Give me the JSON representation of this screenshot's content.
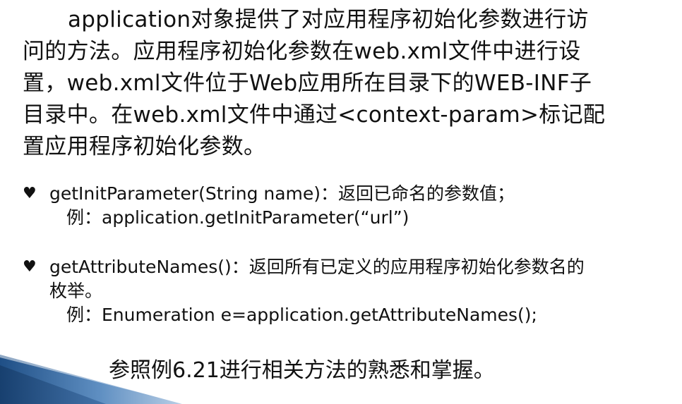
{
  "colors": {
    "text": "#111111",
    "wedge_dark": "#1f4f86",
    "wedge_light": "#8fb2d8"
  },
  "bullet_icon": "heart-bullet",
  "paragraph": {
    "line1": "application对象提供了对应用程序初始化参数进行访",
    "line2": "问的方法。应用程序初始化参数在web.xml文件中进行设",
    "line3": "置，web.xml文件位于Web应用所在目录下的WEB-INF子",
    "line4": "目录中。在web.xml文件中通过<context-param>标记配",
    "line5": "置应用程序初始化参数。"
  },
  "bullets": [
    {
      "glyph": "♥",
      "text": "getInitParameter(String name)：返回已命名的参数值；",
      "example": "例：application.getInitParameter(“url”)"
    },
    {
      "glyph": "♥",
      "text": "getAttributeNames()：返回所有已定义的应用程序初始化参数名的",
      "text_wrap": "枚举。",
      "example": "例：Enumeration e=application.getAttributeNames();"
    }
  ],
  "footer": "参照例6.21进行相关方法的熟悉和掌握。"
}
